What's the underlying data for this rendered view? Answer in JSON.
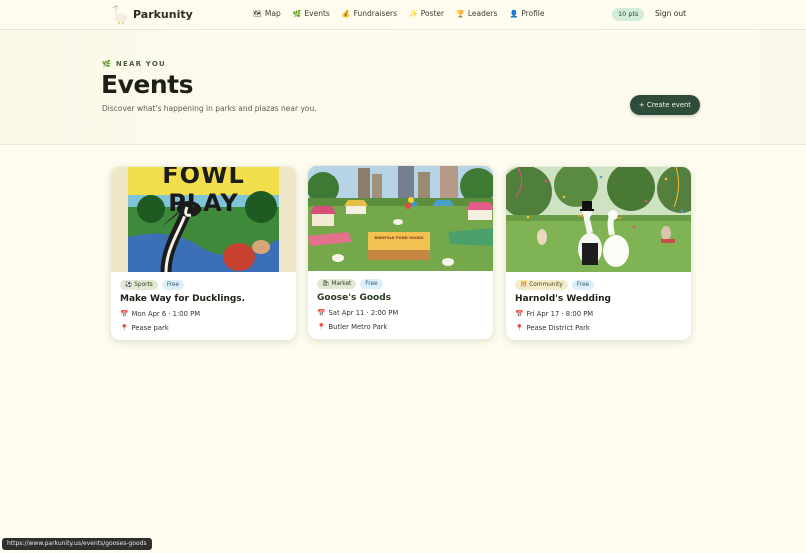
{
  "app": {
    "name": "Parkunity"
  },
  "nav": {
    "links": [
      {
        "icon": "🗺",
        "label": "Map"
      },
      {
        "icon": "🌿",
        "label": "Events"
      },
      {
        "icon": "💰",
        "label": "Fundraisers"
      },
      {
        "icon": "✨",
        "label": "Poster"
      },
      {
        "icon": "🏆",
        "label": "Leaders"
      },
      {
        "icon": "👤",
        "label": "Profile"
      }
    ],
    "points": "10 pts",
    "signout": "Sign out"
  },
  "hero": {
    "eyebrow_icon": "🌿",
    "eyebrow": "NEAR YOU",
    "title": "Events",
    "subtitle": "Discover what's happening in parks and plazas near you.",
    "create_label": "+ Create event"
  },
  "events": [
    {
      "category_icon": "⚽",
      "category": "Sports",
      "price": "Free",
      "title": "Make Way for Ducklings.",
      "date_icon": "📅",
      "date": "Mon Apr 6 · 1:00 PM",
      "location_icon": "📍",
      "location": "Pease park",
      "poster_text": "FOWL PLAY"
    },
    {
      "category_icon": "🛍",
      "category": "Market",
      "price": "Free",
      "title": "Goose's Goods",
      "date_icon": "📅",
      "date": "Sat Apr 11 · 2:00 PM",
      "location_icon": "📍",
      "location": "Butler Metro Park",
      "banner_text": "BIRDFOLK POND GOODS"
    },
    {
      "category_icon": "🎊",
      "category": "Community",
      "price": "Free",
      "title": "Harnold's Wedding",
      "date_icon": "📅",
      "date": "Fri Apr 17 · 8:00 PM",
      "location_icon": "📍",
      "location": "Pease District Park"
    }
  ],
  "status_bar": {
    "url": "https://www.parkunity.us/events/gooses-goods"
  },
  "colors": {
    "background": "#fdfcee",
    "accent": "#2f4b3a",
    "points_badge": "#d3ecd9",
    "free_badge": "#dbeffa",
    "category_badge": "#e0e9d2"
  }
}
